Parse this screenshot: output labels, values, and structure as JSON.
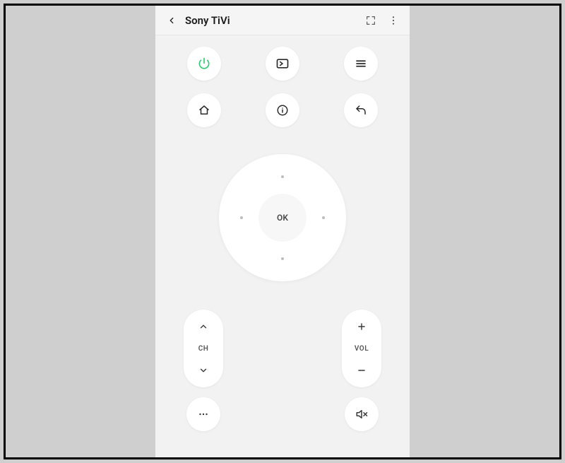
{
  "header": {
    "title": "Sony TiVi"
  },
  "dpad": {
    "ok_label": "OK"
  },
  "rocker": {
    "channel_label": "CH",
    "volume_label": "VOL"
  },
  "colors": {
    "power": "#2ecc71",
    "bg": "#f2f2f2",
    "button_bg": "#ffffff",
    "text": "#2b2b2b"
  },
  "icons": {
    "power": "power",
    "input": "input-source",
    "menu": "hamburger",
    "home": "home",
    "info": "info",
    "back": "return",
    "expand": "expand-corners",
    "overflow": "kebab",
    "ch_up": "chevron-up",
    "ch_down": "chevron-down",
    "vol_up": "plus",
    "vol_down": "minus",
    "more": "dots-horizontal",
    "mute": "speaker-mute"
  }
}
